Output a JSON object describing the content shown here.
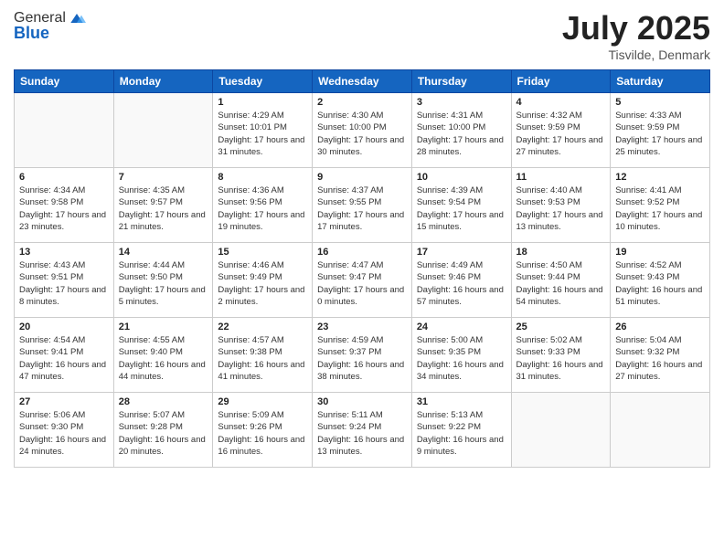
{
  "logo": {
    "line1": "General",
    "line2": "Blue"
  },
  "title": "July 2025",
  "location": "Tisvilde, Denmark",
  "days_header": [
    "Sunday",
    "Monday",
    "Tuesday",
    "Wednesday",
    "Thursday",
    "Friday",
    "Saturday"
  ],
  "weeks": [
    [
      {
        "day": "",
        "info": ""
      },
      {
        "day": "",
        "info": ""
      },
      {
        "day": "1",
        "info": "Sunrise: 4:29 AM\nSunset: 10:01 PM\nDaylight: 17 hours and 31 minutes."
      },
      {
        "day": "2",
        "info": "Sunrise: 4:30 AM\nSunset: 10:00 PM\nDaylight: 17 hours and 30 minutes."
      },
      {
        "day": "3",
        "info": "Sunrise: 4:31 AM\nSunset: 10:00 PM\nDaylight: 17 hours and 28 minutes."
      },
      {
        "day": "4",
        "info": "Sunrise: 4:32 AM\nSunset: 9:59 PM\nDaylight: 17 hours and 27 minutes."
      },
      {
        "day": "5",
        "info": "Sunrise: 4:33 AM\nSunset: 9:59 PM\nDaylight: 17 hours and 25 minutes."
      }
    ],
    [
      {
        "day": "6",
        "info": "Sunrise: 4:34 AM\nSunset: 9:58 PM\nDaylight: 17 hours and 23 minutes."
      },
      {
        "day": "7",
        "info": "Sunrise: 4:35 AM\nSunset: 9:57 PM\nDaylight: 17 hours and 21 minutes."
      },
      {
        "day": "8",
        "info": "Sunrise: 4:36 AM\nSunset: 9:56 PM\nDaylight: 17 hours and 19 minutes."
      },
      {
        "day": "9",
        "info": "Sunrise: 4:37 AM\nSunset: 9:55 PM\nDaylight: 17 hours and 17 minutes."
      },
      {
        "day": "10",
        "info": "Sunrise: 4:39 AM\nSunset: 9:54 PM\nDaylight: 17 hours and 15 minutes."
      },
      {
        "day": "11",
        "info": "Sunrise: 4:40 AM\nSunset: 9:53 PM\nDaylight: 17 hours and 13 minutes."
      },
      {
        "day": "12",
        "info": "Sunrise: 4:41 AM\nSunset: 9:52 PM\nDaylight: 17 hours and 10 minutes."
      }
    ],
    [
      {
        "day": "13",
        "info": "Sunrise: 4:43 AM\nSunset: 9:51 PM\nDaylight: 17 hours and 8 minutes."
      },
      {
        "day": "14",
        "info": "Sunrise: 4:44 AM\nSunset: 9:50 PM\nDaylight: 17 hours and 5 minutes."
      },
      {
        "day": "15",
        "info": "Sunrise: 4:46 AM\nSunset: 9:49 PM\nDaylight: 17 hours and 2 minutes."
      },
      {
        "day": "16",
        "info": "Sunrise: 4:47 AM\nSunset: 9:47 PM\nDaylight: 17 hours and 0 minutes."
      },
      {
        "day": "17",
        "info": "Sunrise: 4:49 AM\nSunset: 9:46 PM\nDaylight: 16 hours and 57 minutes."
      },
      {
        "day": "18",
        "info": "Sunrise: 4:50 AM\nSunset: 9:44 PM\nDaylight: 16 hours and 54 minutes."
      },
      {
        "day": "19",
        "info": "Sunrise: 4:52 AM\nSunset: 9:43 PM\nDaylight: 16 hours and 51 minutes."
      }
    ],
    [
      {
        "day": "20",
        "info": "Sunrise: 4:54 AM\nSunset: 9:41 PM\nDaylight: 16 hours and 47 minutes."
      },
      {
        "day": "21",
        "info": "Sunrise: 4:55 AM\nSunset: 9:40 PM\nDaylight: 16 hours and 44 minutes."
      },
      {
        "day": "22",
        "info": "Sunrise: 4:57 AM\nSunset: 9:38 PM\nDaylight: 16 hours and 41 minutes."
      },
      {
        "day": "23",
        "info": "Sunrise: 4:59 AM\nSunset: 9:37 PM\nDaylight: 16 hours and 38 minutes."
      },
      {
        "day": "24",
        "info": "Sunrise: 5:00 AM\nSunset: 9:35 PM\nDaylight: 16 hours and 34 minutes."
      },
      {
        "day": "25",
        "info": "Sunrise: 5:02 AM\nSunset: 9:33 PM\nDaylight: 16 hours and 31 minutes."
      },
      {
        "day": "26",
        "info": "Sunrise: 5:04 AM\nSunset: 9:32 PM\nDaylight: 16 hours and 27 minutes."
      }
    ],
    [
      {
        "day": "27",
        "info": "Sunrise: 5:06 AM\nSunset: 9:30 PM\nDaylight: 16 hours and 24 minutes."
      },
      {
        "day": "28",
        "info": "Sunrise: 5:07 AM\nSunset: 9:28 PM\nDaylight: 16 hours and 20 minutes."
      },
      {
        "day": "29",
        "info": "Sunrise: 5:09 AM\nSunset: 9:26 PM\nDaylight: 16 hours and 16 minutes."
      },
      {
        "day": "30",
        "info": "Sunrise: 5:11 AM\nSunset: 9:24 PM\nDaylight: 16 hours and 13 minutes."
      },
      {
        "day": "31",
        "info": "Sunrise: 5:13 AM\nSunset: 9:22 PM\nDaylight: 16 hours and 9 minutes."
      },
      {
        "day": "",
        "info": ""
      },
      {
        "day": "",
        "info": ""
      }
    ]
  ]
}
